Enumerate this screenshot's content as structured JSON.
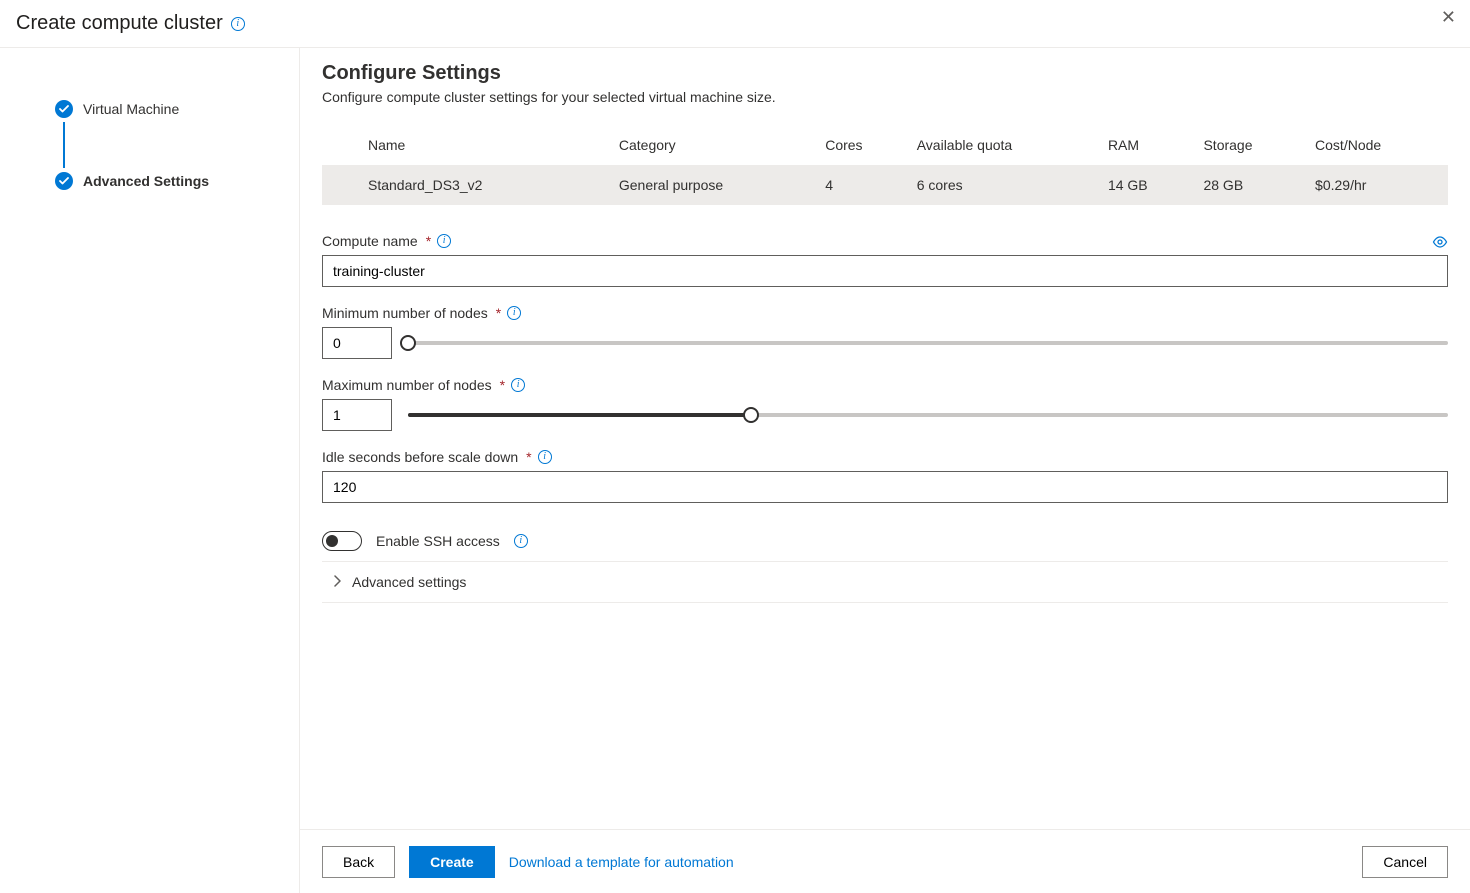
{
  "header": {
    "title": "Create compute cluster"
  },
  "sidebar": {
    "steps": [
      {
        "label": "Virtual Machine"
      },
      {
        "label": "Advanced Settings"
      }
    ]
  },
  "main": {
    "title": "Configure Settings",
    "description": "Configure compute cluster settings for your selected virtual machine size.",
    "table": {
      "headers": {
        "name": "Name",
        "category": "Category",
        "cores": "Cores",
        "quota": "Available quota",
        "ram": "RAM",
        "storage": "Storage",
        "cost": "Cost/Node"
      },
      "row": {
        "name": "Standard_DS3_v2",
        "category": "General purpose",
        "cores": "4",
        "quota": "6 cores",
        "ram": "14 GB",
        "storage": "28 GB",
        "cost": "$0.29/hr"
      }
    },
    "fields": {
      "compute_name": {
        "label": "Compute name",
        "value": "training-cluster"
      },
      "min_nodes": {
        "label": "Minimum number of nodes",
        "value": "0"
      },
      "max_nodes": {
        "label": "Maximum number of nodes",
        "value": "1"
      },
      "idle": {
        "label": "Idle seconds before scale down",
        "value": "120"
      },
      "ssh": {
        "label": "Enable SSH access"
      },
      "advanced": {
        "label": "Advanced settings"
      }
    }
  },
  "footer": {
    "back": "Back",
    "create": "Create",
    "template": "Download a template for automation",
    "cancel": "Cancel"
  }
}
